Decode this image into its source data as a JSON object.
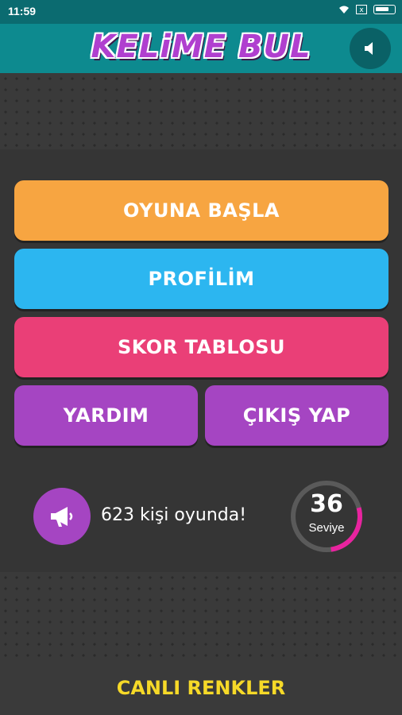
{
  "status_bar": {
    "time": "11:59",
    "sim_label": "x",
    "icons": [
      "wifi-icon",
      "sim-icon",
      "battery-icon"
    ]
  },
  "header": {
    "logo_text": "KELiME BUL",
    "sound_icon": "speaker-icon"
  },
  "menu": {
    "start": "OYUNA BAŞLA",
    "profile": "PROFİLİM",
    "scoreboard": "SKOR TABLOSU",
    "help": "YARDIM",
    "exit": "ÇIKIŞ YAP"
  },
  "info": {
    "online_text": "623 kişi oyunda!",
    "megaphone_icon": "megaphone-icon",
    "level_number": "36",
    "level_label": "Seviye",
    "level_progress": 0.27
  },
  "footer": {
    "link_text": "CANLI RENKLER"
  },
  "colors": {
    "start": "#f7a541",
    "profile": "#2cb6f0",
    "scoreboard": "#ea3f77",
    "help_exit": "#a545c2",
    "accent_progress": "#e8239f",
    "footer_text": "#f6d928",
    "header": "#0d8a8f"
  }
}
